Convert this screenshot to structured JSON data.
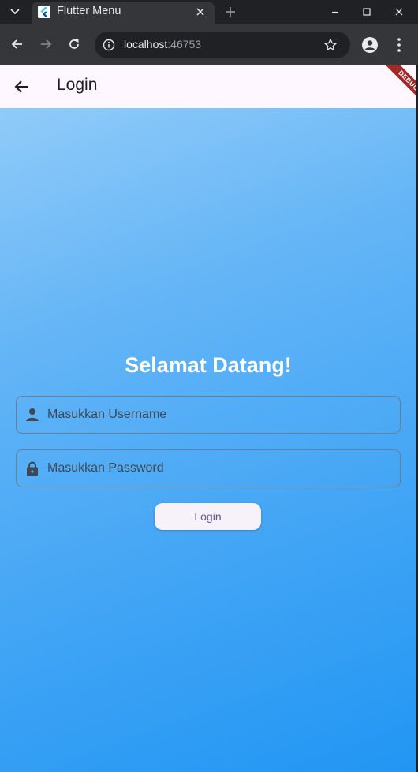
{
  "browser": {
    "tab_title": "Flutter Menu",
    "url_host": "localhost",
    "url_port": ":46753"
  },
  "appbar": {
    "title": "Login",
    "debug_banner": "DEBUG"
  },
  "login": {
    "heading": "Selamat Datang!",
    "username_placeholder": "Masukkan Username",
    "password_placeholder": "Masukkan Password",
    "button_label": "Login"
  },
  "icons": {
    "back": "arrow-back-icon",
    "user": "person-icon",
    "lock": "lock-icon"
  },
  "colors": {
    "appbar_bg": "#fef7ff",
    "gradient_start": "#90cbf9",
    "gradient_end": "#2196f3",
    "button_text": "#65558f",
    "heading": "#ffffff"
  }
}
